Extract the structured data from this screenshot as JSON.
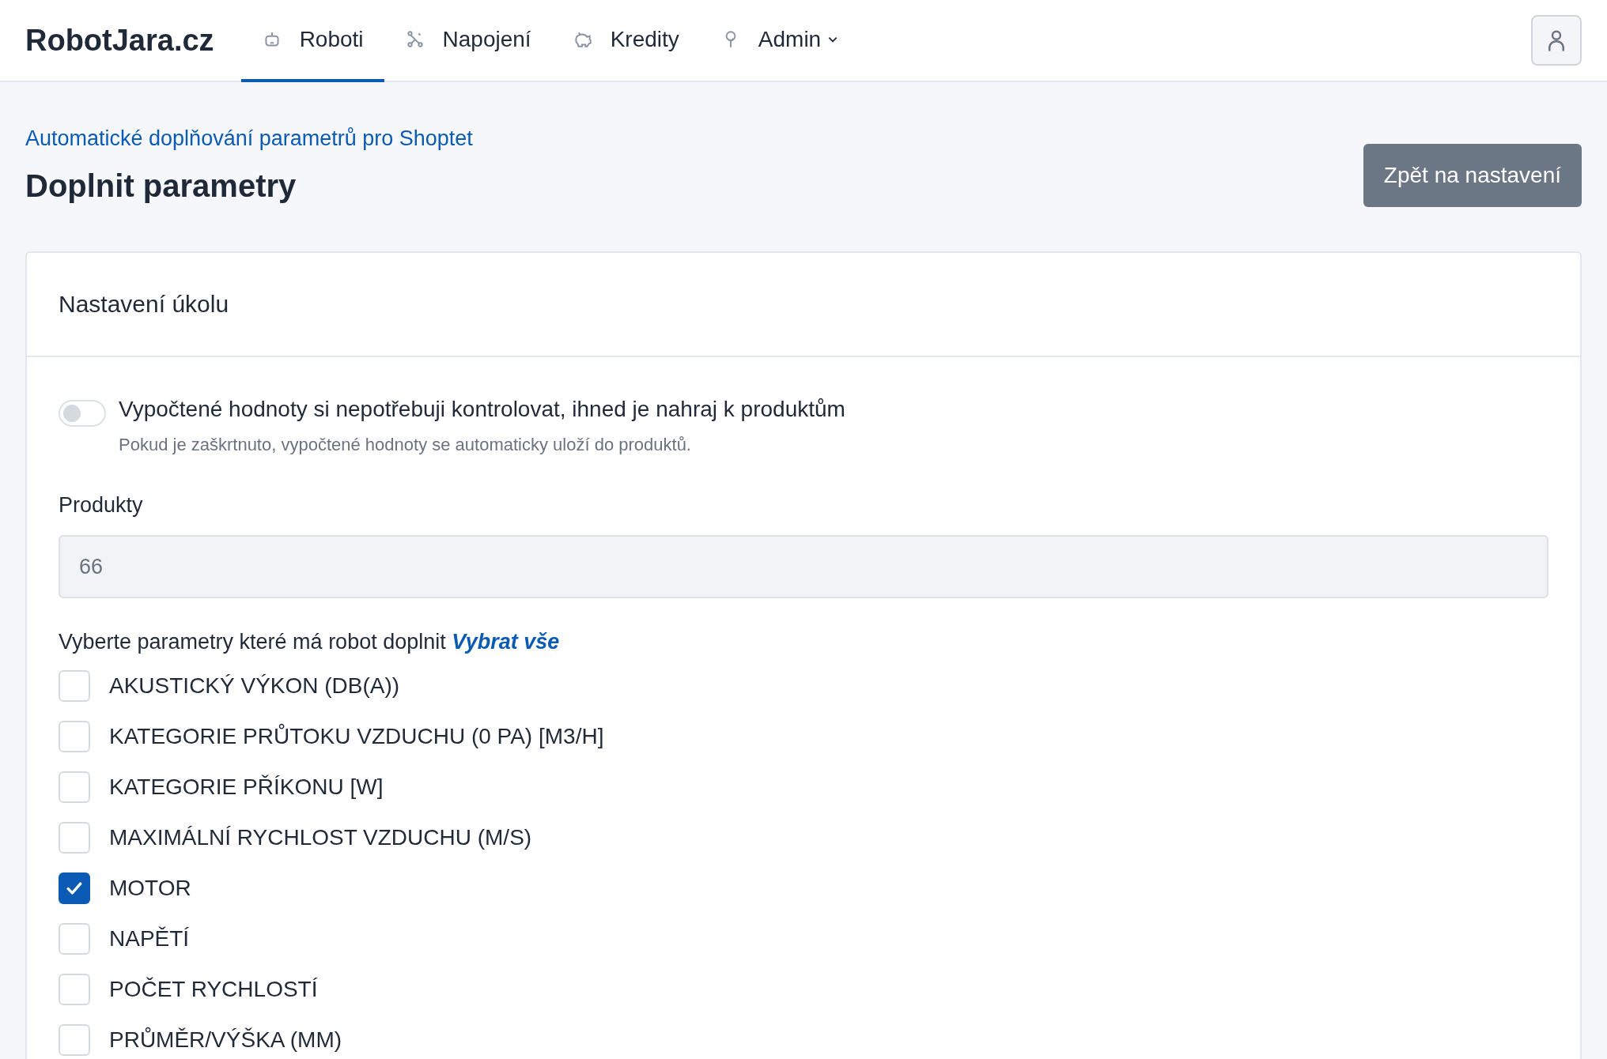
{
  "brand": "RobotJara.cz",
  "nav": [
    {
      "label": "Roboti",
      "kind": "link",
      "selected": true
    },
    {
      "label": "Napojení",
      "kind": "link",
      "selected": false
    },
    {
      "label": "Kredity",
      "kind": "link",
      "selected": false
    },
    {
      "label": "Admin",
      "kind": "menu",
      "selected": false
    }
  ],
  "breadcrumb": "Automatické doplňování parametrů pro Shoptet",
  "title": "Doplnit parametry",
  "back_button": "Zpět na nastavení",
  "card": {
    "title": "Nastavení úkolu",
    "toggle": {
      "label": "Vypočtené hodnoty si nepotřebuji kontrolovat, ihned je nahraj k produktům",
      "help": "Pokud je zaškrtnuto, vypočtené hodnoty se automaticky uloží do produktů.",
      "on": false
    },
    "products": {
      "label": "Produkty",
      "value": "66"
    },
    "params_label": "Vyberte parametry které má robot doplnit",
    "select_all": "Vybrat vše",
    "params": [
      {
        "label": "AKUSTICKÝ VÝKON (DB(A))",
        "checked": false
      },
      {
        "label": "KATEGORIE PRŮTOKU VZDUCHU (0 PA) [M3/H]",
        "checked": false
      },
      {
        "label": "KATEGORIE PŘÍKONU [W]",
        "checked": false
      },
      {
        "label": "MAXIMÁLNÍ RYCHLOST VZDUCHU (M/S)",
        "checked": false
      },
      {
        "label": "MOTOR",
        "checked": true
      },
      {
        "label": "NAPĚTÍ",
        "checked": false
      },
      {
        "label": "POČET RYCHLOSTÍ",
        "checked": false
      },
      {
        "label": "PRŮMĚR/VÝŠKA (MM)",
        "checked": false
      }
    ]
  }
}
